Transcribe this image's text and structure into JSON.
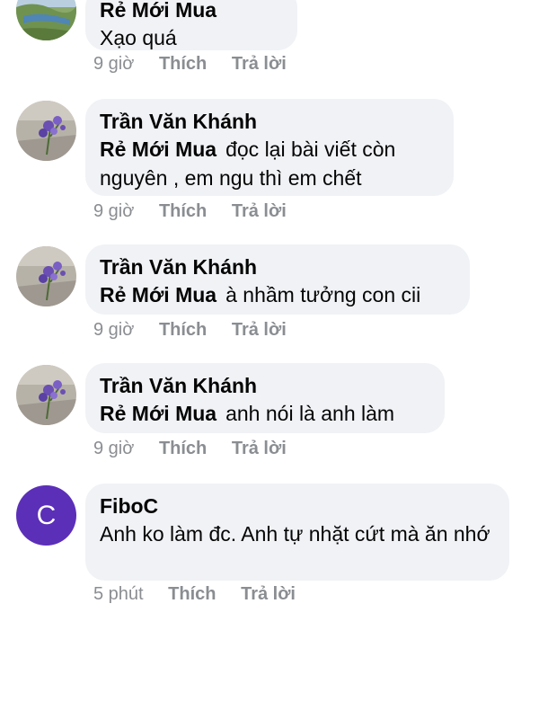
{
  "comments": [
    {
      "author": "Rẻ Mới Mua",
      "text": "Xạo quá",
      "time": "9 giờ",
      "like_label": "Thích",
      "reply_label": "Trả lời"
    },
    {
      "author": "Trần Văn Khánh",
      "mention": "Rẻ Mới Mua",
      "text": "đọc lại bài viết còn nguyên , em ngu thì em chết",
      "time": "9 giờ",
      "like_label": "Thích",
      "reply_label": "Trả lời"
    },
    {
      "author": "Trần Văn Khánh",
      "mention": "Rẻ Mới Mua",
      "text": "à nhầm tưởng con cii",
      "time": "9 giờ",
      "like_label": "Thích",
      "reply_label": "Trả lời"
    },
    {
      "author": "Trần Văn Khánh",
      "mention": "Rẻ Mới Mua",
      "text": "anh nói là anh làm",
      "time": "9 giờ",
      "like_label": "Thích",
      "reply_label": "Trả lời"
    },
    {
      "author": "FiboC",
      "avatar_letter": "C",
      "avatar_color": "#5b2fb8",
      "text": "Anh ko làm đc. Anh tự nhặt cứt mà ăn nhớ",
      "time": "5 phút",
      "like_label": "Thích",
      "reply_label": "Trả lời"
    }
  ]
}
